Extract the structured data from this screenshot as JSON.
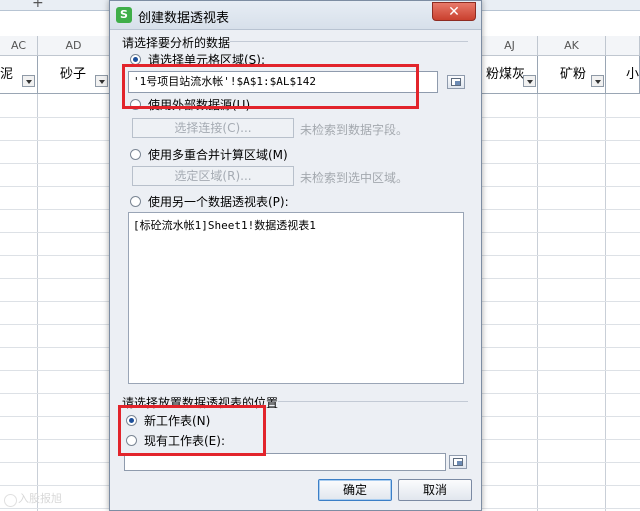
{
  "sheet": {
    "columns": [
      {
        "id": "col-ac",
        "letter": "AC"
      },
      {
        "id": "col-ad",
        "letter": "AD"
      },
      {
        "id": "col-aj",
        "letter": "AJ"
      },
      {
        "id": "col-ak",
        "letter": "AK"
      }
    ],
    "headers": [
      {
        "id": "hdr-ni",
        "text": "泥"
      },
      {
        "id": "hdr-shazi",
        "text": "砂子"
      },
      {
        "id": "hdr-fenmeihui",
        "text": "粉煤灰"
      },
      {
        "id": "hdr-kuangfen",
        "text": "矿粉"
      },
      {
        "id": "hdr-xiao",
        "text": "小"
      }
    ],
    "tab_add": "+"
  },
  "dialog": {
    "app_icon": "S",
    "title": "创建数据透视表",
    "close_icon": "close-icon",
    "section1_label": "请选择要分析的数据",
    "opt_range_label": "请选择单元格区域(S):",
    "range_value": "'1号项目站流水帐'!$A$1:$AL$142",
    "opt_external_label": "使用外部数据源(U)",
    "select_connection_label": "选择连接(C)...",
    "no_fields_hint": "未检索到数据字段。",
    "opt_multi_label": "使用多重合并计算区域(M)",
    "select_area_label": "选定区域(R)...",
    "no_area_hint": "未检索到选中区域。",
    "opt_other_pivot_label": "使用另一个数据透视表(P):",
    "pivot_list_item": "[标砼流水帐1]Sheet1!数据透视表1",
    "section2_label": "请选择放置数据透视表的位置",
    "opt_new_sheet_label": "新工作表(N)",
    "opt_existing_sheet_label": "现有工作表(E):",
    "existing_value": "",
    "ok_label": "确定",
    "cancel_label": "取消"
  },
  "watermark": "入股报旭",
  "colors": {
    "highlight": "#e2242b",
    "accent": "#3c7fc7"
  }
}
